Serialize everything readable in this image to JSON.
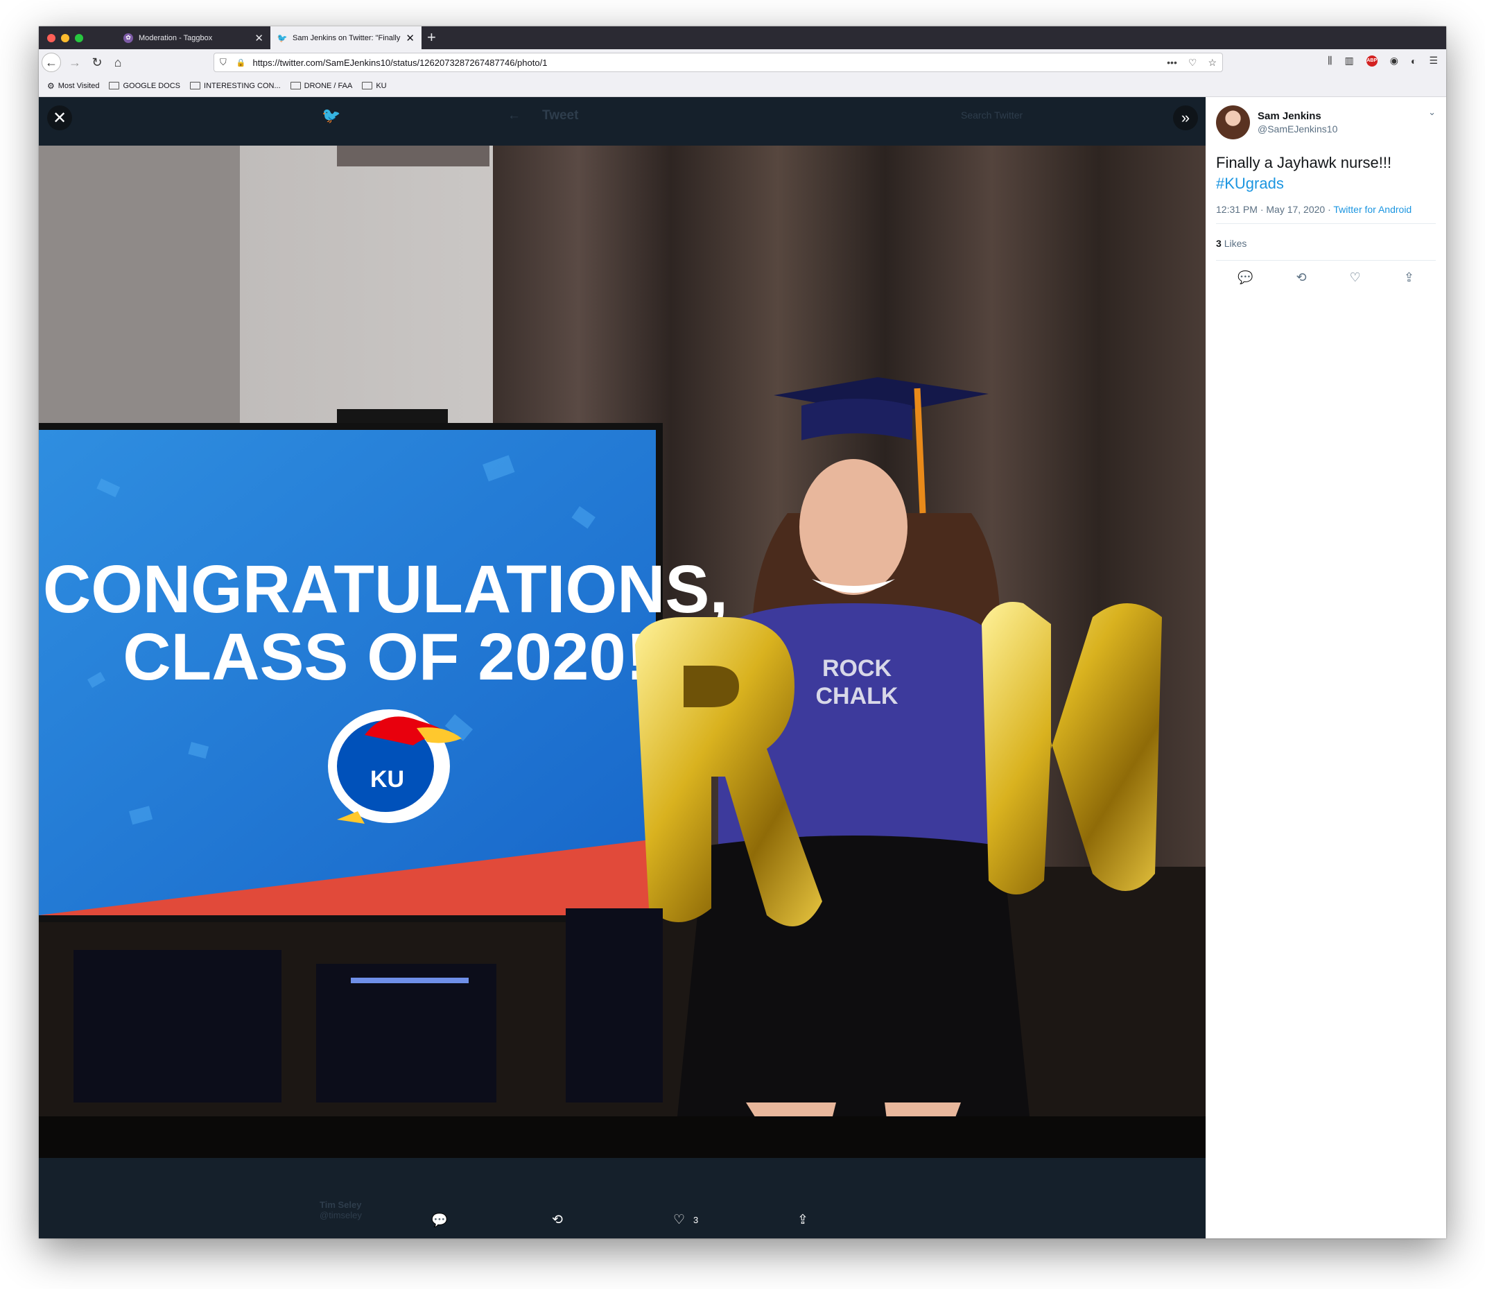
{
  "colors": {
    "chrome_dark": "#2b2a33",
    "twitter_blue": "#1b95e0",
    "dark_navy": "#15202b"
  },
  "tabs": [
    {
      "title": "Moderation - Taggbox",
      "icon": "taggbox-icon"
    },
    {
      "title": "Sam Jenkins on Twitter: \"Finally",
      "icon": "twitter-bird-icon"
    }
  ],
  "url": "https://twitter.com/SamEJenkins10/status/1262073287267487746/photo/1",
  "bookmarks": [
    "Most Visited",
    "GOOGLE DOCS",
    "INTERESTING CON...",
    "DRONE / FAA",
    "KU"
  ],
  "viewer": {
    "ghost_header_title": "Tweet",
    "ghost_search": "Search Twitter",
    "ghost_user_name": "Tim Seley",
    "ghost_user_handle": "@timseley",
    "photo": {
      "tv_line1": "CONGRATULATIONS,",
      "tv_line2": "CLASS OF 2020!",
      "ku_logo": "KU",
      "shirt_line1": "ROCK",
      "shirt_line2": "CHALK",
      "balloons": "RN"
    },
    "bottom_like_count": "3"
  },
  "tweet": {
    "name": "Sam Jenkins",
    "handle": "@SamEJenkins10",
    "text": "Finally a Jayhawk nurse!!!",
    "hashtag": "#KUgrads",
    "time": "12:31 PM · May 17, 2020 · ",
    "source": "Twitter for Android",
    "likes_count": "3",
    "likes_label": "Likes"
  }
}
